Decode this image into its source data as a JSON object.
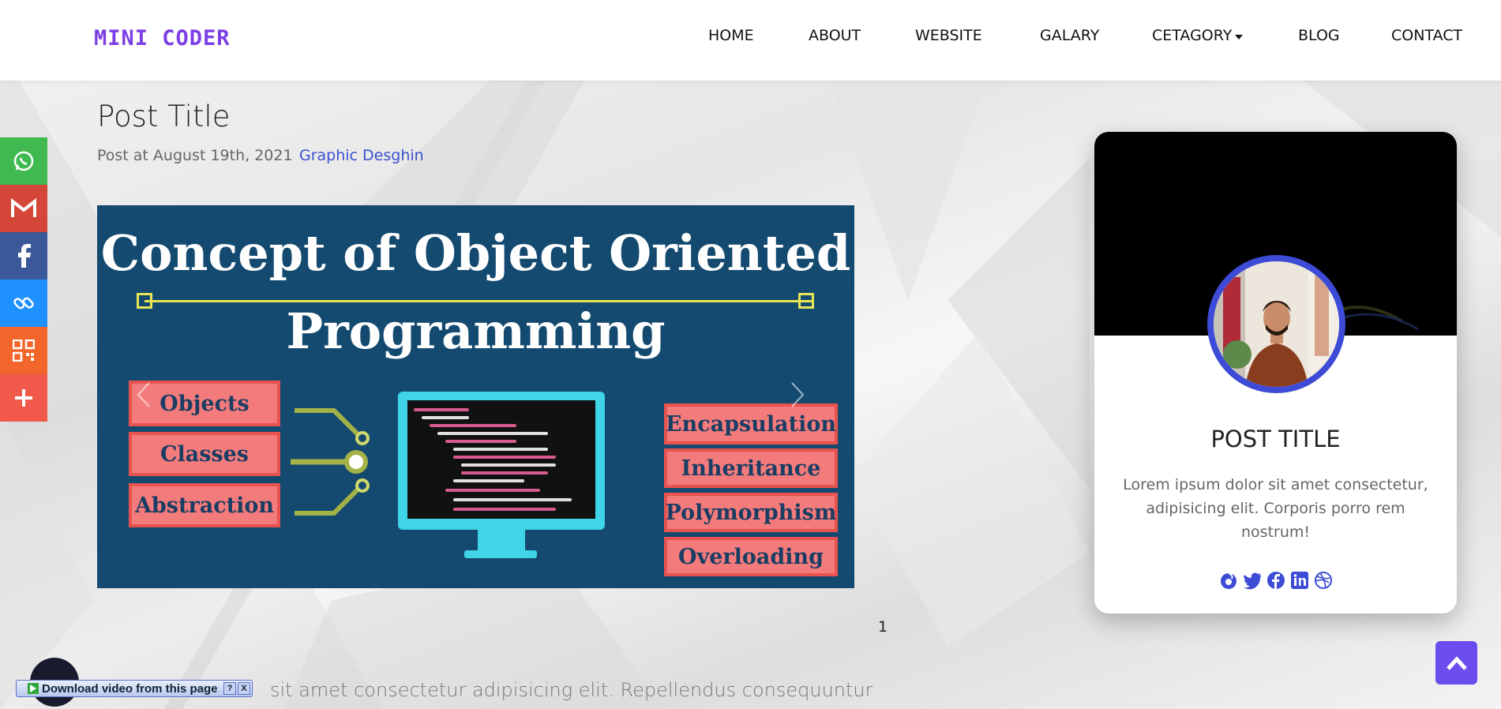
{
  "brand": {
    "logo_text": "MINI CODER"
  },
  "nav": {
    "items": [
      {
        "label": "HOME"
      },
      {
        "label": "ABOUT"
      },
      {
        "label": "WEBSITE"
      },
      {
        "label": "GALARY"
      },
      {
        "label": "CETAGORY"
      },
      {
        "label": "BLOG"
      },
      {
        "label": "CONTACT"
      }
    ]
  },
  "share_bar": {
    "icons": [
      "whatsapp-icon",
      "gmail-icon",
      "facebook-icon",
      "link-icon",
      "qr-code-icon",
      "plus-icon"
    ],
    "colors": [
      "#3fb950",
      "#d44638",
      "#3b5998",
      "#1e90ff",
      "#f2662b",
      "#f15a4a"
    ]
  },
  "post": {
    "title": "Post Title",
    "meta": "Post at August 19th, 2021",
    "category": "Graphic Desghin",
    "page_number": "1",
    "body_preview": "sit amet consectetur adipisicing elit. Repellendus consequuntur"
  },
  "slide": {
    "title_line1": "Concept of Object Oriented",
    "title_line2": "Programming",
    "left_items": [
      "Objects",
      "Classes",
      "Abstraction"
    ],
    "right_items": [
      "Encapsulation",
      "Inheritance",
      "Polymorphism",
      "Overloading"
    ]
  },
  "card": {
    "title": "POST TITLE",
    "text": "Lorem ipsum dolor sit amet consectetur, adipisicing elit. Corporis porro rem nostrum!",
    "social_icons": [
      "codepen-swirl-icon",
      "twitter-icon",
      "facebook-icon",
      "linkedin-icon",
      "dribbble-icon"
    ],
    "accent": "#3d4bd6"
  },
  "download_widget": {
    "label": "Download video from this page",
    "help": "?",
    "close": "X"
  },
  "colors": {
    "brand": "#7b3fe4",
    "link": "#3b4fd0",
    "slide_bg": "#144a70",
    "scroll_top": "#6c4dee"
  }
}
